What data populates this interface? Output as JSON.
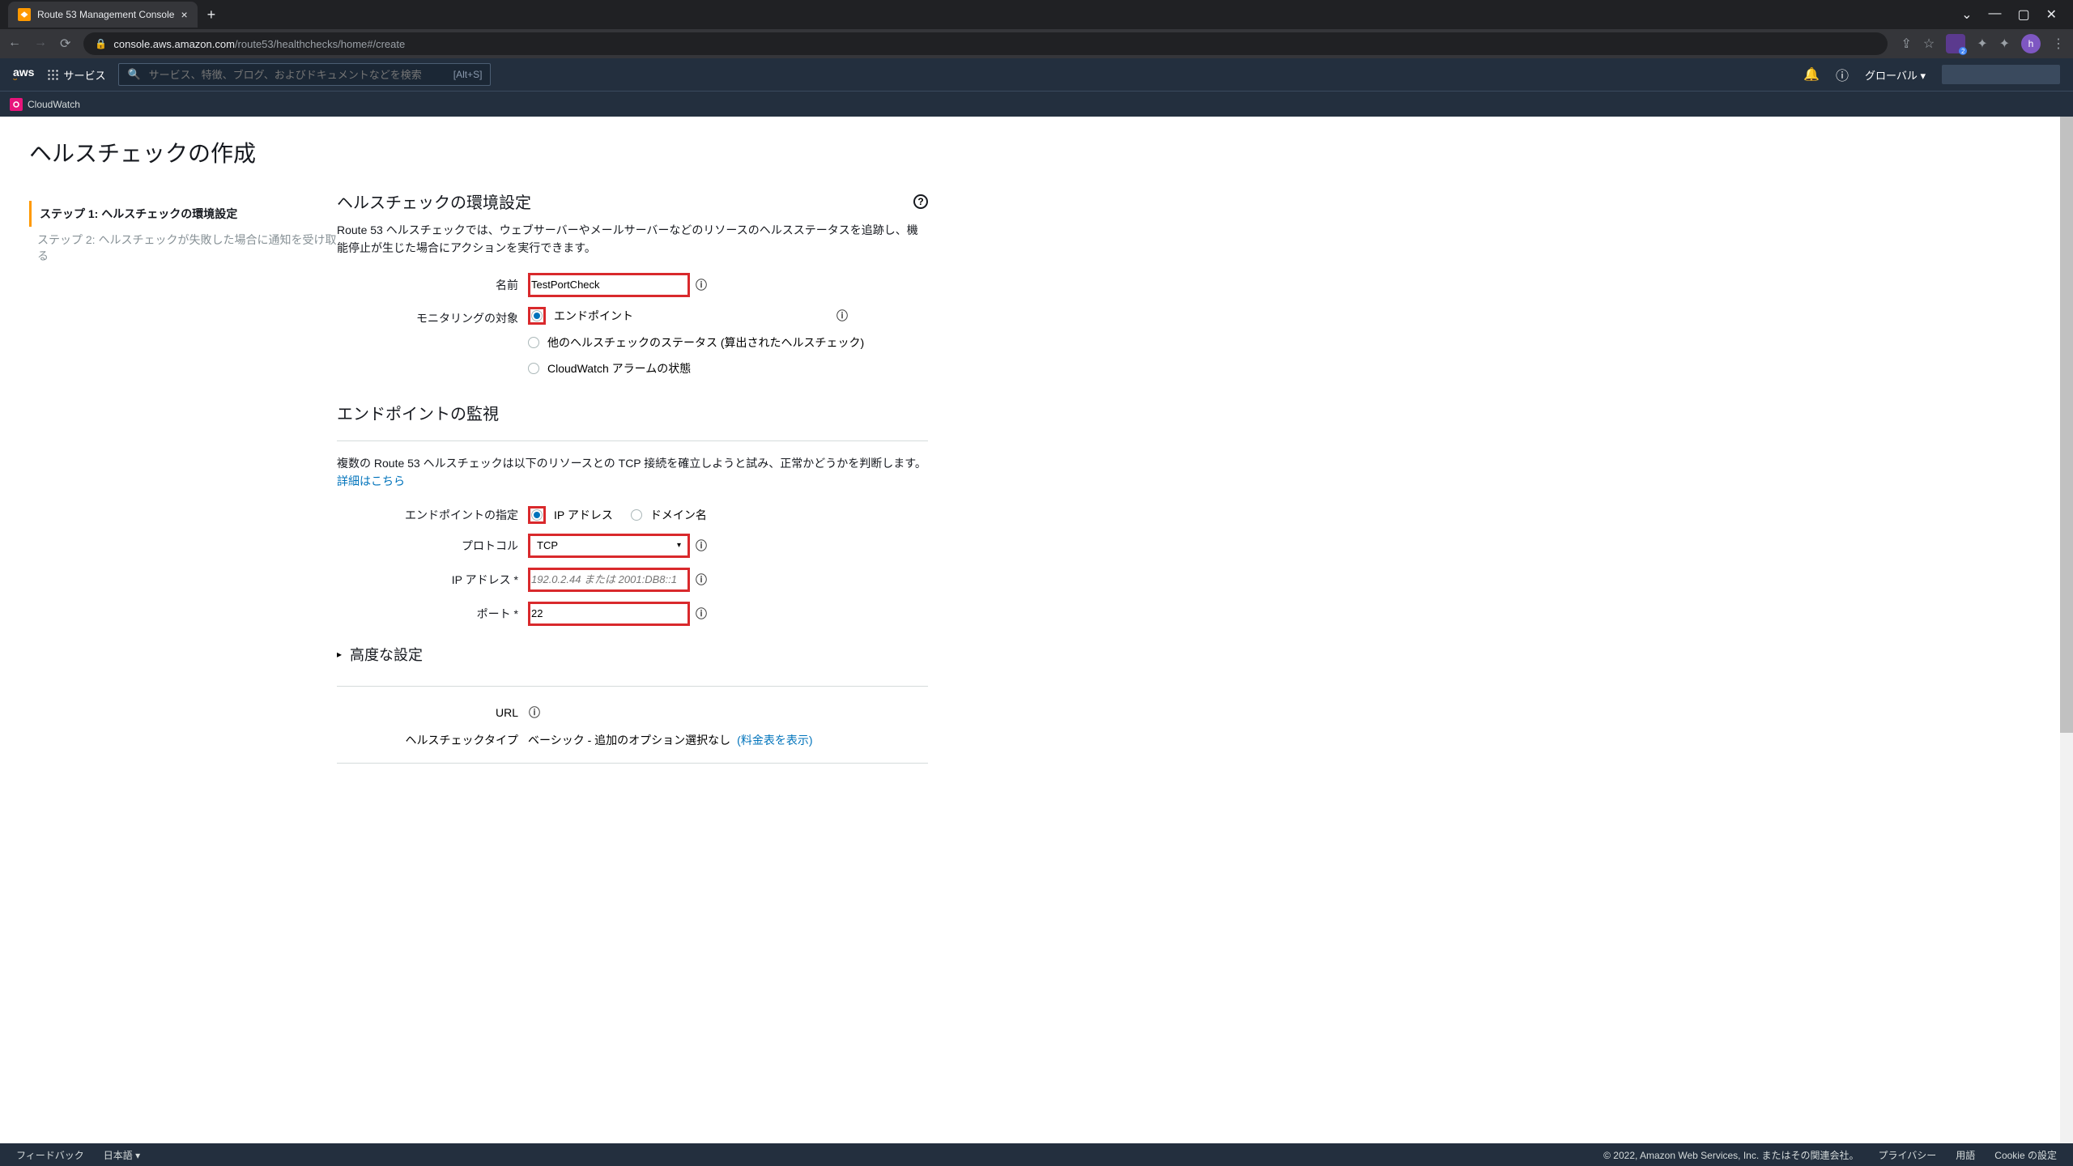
{
  "browser": {
    "tab_title": "Route 53 Management Console",
    "url_host": "console.aws.amazon.com",
    "url_path": "/route53/healthchecks/home#/create",
    "avatar_letter": "h"
  },
  "header": {
    "services_label": "サービス",
    "search_placeholder": "サービス、特徴、ブログ、およびドキュメントなどを検索",
    "search_shortcut": "[Alt+S]",
    "region": "グローバル ▾",
    "subnav_item": "CloudWatch"
  },
  "page": {
    "title": "ヘルスチェックの作成"
  },
  "steps": {
    "s1": "ステップ 1: ヘルスチェックの環境設定",
    "s2": "ステップ 2: ヘルスチェックが失敗した場合に通知を受け取る"
  },
  "section1": {
    "title": "ヘルスチェックの環境設定",
    "desc": "Route 53 ヘルスチェックでは、ウェブサーバーやメールサーバーなどのリソースのヘルスステータスを追跡し、機能停止が生じた場合にアクションを実行できます。",
    "name_label": "名前",
    "name_value": "TestPortCheck",
    "monitor_label": "モニタリングの対象",
    "opt_endpoint": "エンドポイント",
    "opt_other_hc": "他のヘルスチェックのステータス (算出されたヘルスチェック)",
    "opt_cw_alarm": "CloudWatch アラームの状態"
  },
  "section2": {
    "title": "エンドポイントの監視",
    "desc_pre": "複数の Route 53 ヘルスチェックは以下のリソースとの TCP 接続を確立しようと試み、正常かどうかを判断します。 ",
    "desc_link": "詳細はこちら",
    "specify_label": "エンドポイントの指定",
    "opt_ip": "IP アドレス",
    "opt_domain": "ドメイン名",
    "protocol_label": "プロトコル",
    "protocol_value": "TCP",
    "ip_label": "IP アドレス *",
    "ip_placeholder": "192.0.2.44 または 2001:DB8::1",
    "port_label": "ポート *",
    "port_value": "22",
    "advanced_label": "高度な設定"
  },
  "summary": {
    "url_label": "URL",
    "type_label": "ヘルスチェックタイプ",
    "type_value": "ベーシック - 追加のオプション選択なし ",
    "type_link": "(料金表を表示)"
  },
  "footer": {
    "feedback": "フィードバック",
    "language": "日本語 ▾",
    "copyright": "© 2022, Amazon Web Services, Inc. またはその関連会社。",
    "privacy": "プライバシー",
    "terms": "用語",
    "cookies": "Cookie の設定"
  }
}
